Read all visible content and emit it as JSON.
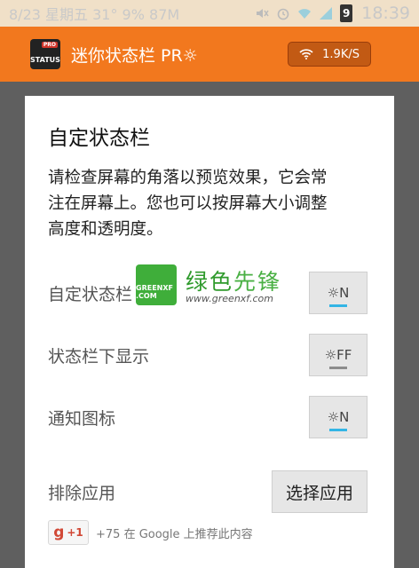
{
  "status_bar": {
    "left_text": "8/23 星期五 31°  9%  87M",
    "battery": "9",
    "clock": "18:39"
  },
  "app_bar": {
    "logo_text": "STATUS",
    "logo_badge": "PRO",
    "title": "迷你状态栏 PR☼",
    "speed": "1.9K/S"
  },
  "dialog": {
    "title": "自定状态栏",
    "description": "请检查屏幕的角落以预览效果，它会常注在屏幕上。您也可以按屏幕大小调整高度和透明度。",
    "rows": [
      {
        "label": "自定状态栏",
        "toggle": "☼N",
        "state": "on"
      },
      {
        "label": "状态栏下显示",
        "toggle": "☼FF",
        "state": "off"
      },
      {
        "label": "通知图标",
        "toggle": "☼N",
        "state": "on"
      }
    ],
    "exclude_label": "排除应用",
    "choose_button": "选择应用",
    "plus_one": {
      "g": "g",
      "label": "+1",
      "text": "+75 在 Google 上推荐此内容"
    }
  },
  "watermark": {
    "logo_text": "GREENXF .COM",
    "title_green": "绿色",
    "title_light": "先锋",
    "url": "www.greenxf.com"
  },
  "colors": {
    "accent": "#f2781e",
    "toggle_on": "#33b5e5",
    "toggle_off": "#8c8c8c"
  },
  "icons": [
    "wifi-icon",
    "mute-icon",
    "alarm-icon",
    "signal-icon",
    "battery-icon",
    "sun-icon",
    "google-plus-icon"
  ]
}
